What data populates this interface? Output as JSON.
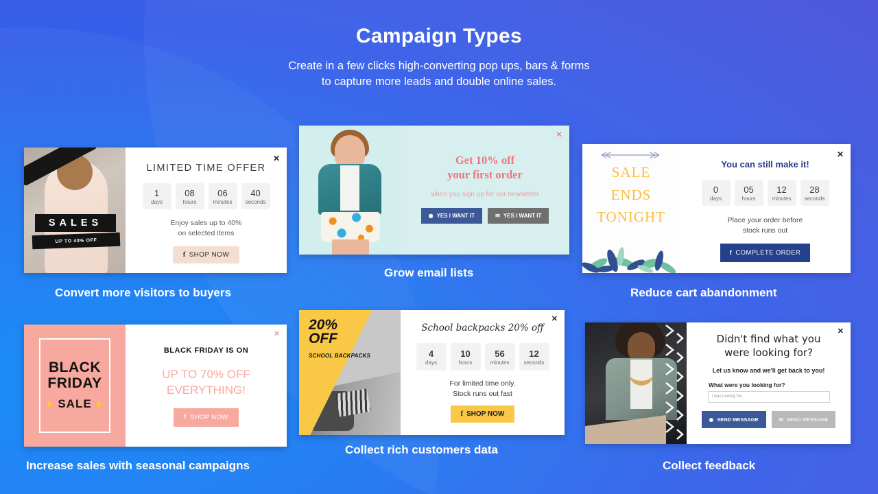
{
  "header": {
    "title": "Campaign Types",
    "subtitle_line1": "Create in a few clicks high-converting pop ups, bars & forms",
    "subtitle_line2": "to capture more leads and double online sales."
  },
  "colors": {
    "bg_left": "#1189f7",
    "bg_right": "#4a4fd8",
    "facebook_blue": "#3b5998",
    "pink": "#f7a9a0",
    "yellow": "#f8c846",
    "navy": "#23418c",
    "coral": "#f0737b"
  },
  "cards": [
    {
      "caption": "Convert more visitors to buyers",
      "close_icon": "close-icon",
      "heading": "LIMITED TIME OFFER",
      "image_text": {
        "band": "SALES",
        "subband": "UP TO 40% OFF"
      },
      "countdown": [
        {
          "value": "1",
          "unit": "days"
        },
        {
          "value": "08",
          "unit": "hours"
        },
        {
          "value": "06",
          "unit": "minutes"
        },
        {
          "value": "40",
          "unit": "seconds"
        }
      ],
      "body_line1": "Enjoy sales up to 40%",
      "body_line2": "on selected items",
      "button": {
        "label": "SHOP NOW",
        "icon": "facebook-icon"
      }
    },
    {
      "caption": "Grow email lists",
      "close_icon": "close-icon",
      "heading_line1": "Get 10% off",
      "heading_line2": "your first order",
      "body_line1": "when you sign up for our newsletter",
      "button_fb": {
        "label": "YES I WANT IT",
        "icon": "facebook-icon"
      },
      "button_mail": {
        "label": "YES I WANT IT",
        "icon": "envelope-icon"
      }
    },
    {
      "caption": "Reduce cart abandonment",
      "close_icon": "close-icon",
      "image_text": {
        "l1": "SALE",
        "l2": "ENDS",
        "l3": "TONIGHT"
      },
      "heading": "You can still make it!",
      "countdown": [
        {
          "value": "0",
          "unit": "days"
        },
        {
          "value": "05",
          "unit": "hours"
        },
        {
          "value": "12",
          "unit": "minutes"
        },
        {
          "value": "28",
          "unit": "seconds"
        }
      ],
      "body_line1": "Place your order before",
      "body_line2": "stock runs out",
      "button": {
        "label": "COMPLETE ORDER",
        "icon": "facebook-icon"
      }
    },
    {
      "caption": "Increase sales with seasonal campaigns",
      "close_icon": "close-icon",
      "image_text": {
        "l1": "BLACK",
        "l2": "FRIDAY",
        "l3": "SALE"
      },
      "heading": "BLACK FRIDAY IS ON",
      "body_line1": "UP TO 70% OFF",
      "body_line2": "EVERYTHING!",
      "button": {
        "label": "SHOP NOW",
        "icon": "facebook-icon"
      }
    },
    {
      "caption": "Collect rich customers data",
      "close_icon": "close-icon",
      "image_text": {
        "l1": "20%",
        "l2": "OFF",
        "l3": "SCHOOL BACKPACKS"
      },
      "heading": "School backpacks 20% off",
      "countdown": [
        {
          "value": "4",
          "unit": "days"
        },
        {
          "value": "10",
          "unit": "hours"
        },
        {
          "value": "56",
          "unit": "minutes"
        },
        {
          "value": "12",
          "unit": "seconds"
        }
      ],
      "body_line1": "For limited time only.",
      "body_line2": "Stock runs out fast",
      "button": {
        "label": "SHOP NOW",
        "icon": "facebook-icon"
      }
    },
    {
      "caption": "Collect feedback",
      "close_icon": "close-icon",
      "heading_line1": "Didn't find what you",
      "heading_line2": "were looking for?",
      "body_line1": "Let us know and we'll get back to you!",
      "field_label": "What were you looking for?",
      "field_placeholder": "I was looking for..",
      "field_value": "",
      "button_fb": {
        "label": "SEND MESSAGE",
        "icon": "facebook-icon"
      },
      "button_mail": {
        "label": "SEND MESSAGE",
        "icon": "envelope-icon"
      }
    }
  ]
}
